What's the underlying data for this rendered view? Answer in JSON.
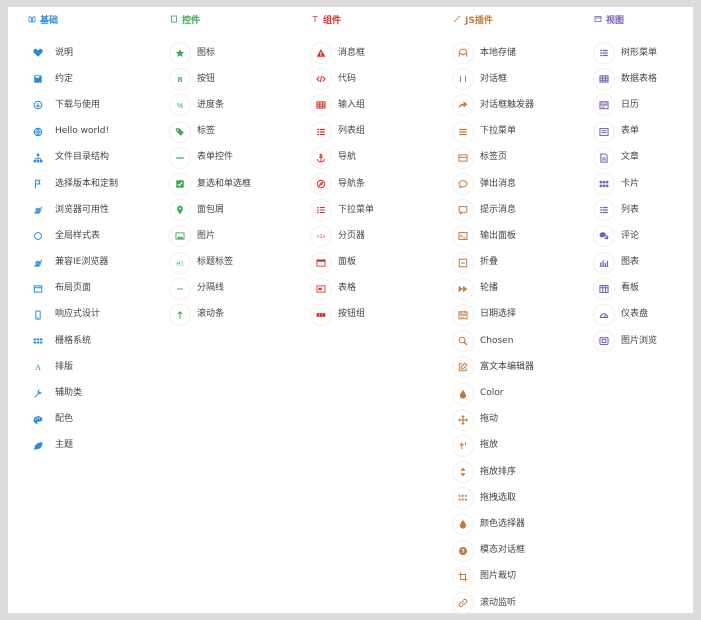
{
  "columns": [
    {
      "key": "base",
      "header": "基础",
      "icon": "book-icon",
      "color": "#2b8cd6",
      "items": [
        {
          "label": "说明",
          "icon": "heart-icon"
        },
        {
          "label": "约定",
          "icon": "save-icon"
        },
        {
          "label": "下载与使用",
          "icon": "download-icon"
        },
        {
          "label": "Hello world!",
          "icon": "globe-icon"
        },
        {
          "label": "文件目录结构",
          "icon": "sitemap-icon"
        },
        {
          "label": "选择版本和定制",
          "icon": "flag-icon"
        },
        {
          "label": "浏览器可用性",
          "icon": "ie-icon"
        },
        {
          "label": "全局样式表",
          "icon": "circle-icon"
        },
        {
          "label": "兼容IE浏览器",
          "icon": "ie-icon"
        },
        {
          "label": "布局页面",
          "icon": "window-icon"
        },
        {
          "label": "响应式设计",
          "icon": "mobile-icon"
        },
        {
          "label": "栅格系统",
          "icon": "grid-icon"
        },
        {
          "label": "排版",
          "icon": "font-icon"
        },
        {
          "label": "辅助类",
          "icon": "wrench-icon"
        },
        {
          "label": "配色",
          "icon": "palette-icon"
        },
        {
          "label": "主题",
          "icon": "leaf-icon"
        }
      ]
    },
    {
      "key": "widget",
      "header": "控件",
      "icon": "square-icon",
      "color": "#3aa94f",
      "items": [
        {
          "label": "图标",
          "icon": "star-icon"
        },
        {
          "label": "按钮",
          "icon": "bold-icon"
        },
        {
          "label": "进度条",
          "icon": "percent-icon"
        },
        {
          "label": "标签",
          "icon": "tags-icon"
        },
        {
          "label": "表单控件",
          "icon": "minus-icon"
        },
        {
          "label": "复选和单选框",
          "icon": "check-square-icon"
        },
        {
          "label": "面包屑",
          "icon": "pin-icon"
        },
        {
          "label": "图片",
          "icon": "image-icon"
        },
        {
          "label": "标题标签",
          "icon": "h-icon"
        },
        {
          "label": "分隔线",
          "icon": "dash-icon"
        },
        {
          "label": "滚动条",
          "icon": "arrow-up-icon"
        }
      ]
    },
    {
      "key": "comp",
      "header": "组件",
      "icon": "t-icon",
      "color": "#d9302c",
      "items": [
        {
          "label": "消息框",
          "icon": "warning-icon"
        },
        {
          "label": "代码",
          "icon": "code-icon"
        },
        {
          "label": "输入组",
          "icon": "table-icon"
        },
        {
          "label": "列表组",
          "icon": "list-icon"
        },
        {
          "label": "导航",
          "icon": "anchor-icon"
        },
        {
          "label": "导航条",
          "icon": "compass-icon"
        },
        {
          "label": "下拉菜单",
          "icon": "list-ul-icon"
        },
        {
          "label": "分页器",
          "icon": "pager-icon"
        },
        {
          "label": "面板",
          "icon": "panel-icon"
        },
        {
          "label": "表格",
          "icon": "card-icon"
        },
        {
          "label": "按钮组",
          "icon": "btn-group-icon"
        }
      ]
    },
    {
      "key": "js",
      "header": "JS插件",
      "icon": "magic-icon",
      "color": "#c67a3a",
      "items": [
        {
          "label": "本地存储",
          "icon": "archive-icon"
        },
        {
          "label": "对话框",
          "icon": "columns-icon"
        },
        {
          "label": "对话框触发器",
          "icon": "share-icon"
        },
        {
          "label": "下拉菜单",
          "icon": "bars-icon"
        },
        {
          "label": "标签页",
          "icon": "folder-icon"
        },
        {
          "label": "弹出消息",
          "icon": "comment-icon"
        },
        {
          "label": "提示消息",
          "icon": "comment-alt-icon"
        },
        {
          "label": "输出面板",
          "icon": "console-icon"
        },
        {
          "label": "折叠",
          "icon": "collapse-icon"
        },
        {
          "label": "轮播",
          "icon": "forward-icon"
        },
        {
          "label": "日期选择",
          "icon": "calendar-icon"
        },
        {
          "label": "Chosen",
          "icon": "search-icon"
        },
        {
          "label": "富文本编辑器",
          "icon": "edit-icon"
        },
        {
          "label": "Color",
          "icon": "drop-icon"
        },
        {
          "label": "拖动",
          "icon": "move-icon"
        },
        {
          "label": "拖放",
          "icon": "drag-icon"
        },
        {
          "label": "拖放排序",
          "icon": "sort-icon"
        },
        {
          "label": "拖拽选取",
          "icon": "select-icon"
        },
        {
          "label": "颜色选择器",
          "icon": "drop-icon"
        },
        {
          "label": "模态对话框",
          "icon": "question-icon"
        },
        {
          "label": "图片裁切",
          "icon": "crop-icon"
        },
        {
          "label": "滚动监听",
          "icon": "link-icon"
        }
      ]
    },
    {
      "key": "view",
      "header": "视图",
      "icon": "window-icon",
      "color": "#7a5bb5",
      "items": [
        {
          "label": "树形菜单",
          "icon": "list-icon"
        },
        {
          "label": "数据表格",
          "icon": "table-icon"
        },
        {
          "label": "日历",
          "icon": "calendar-icon"
        },
        {
          "label": "表单",
          "icon": "form-icon"
        },
        {
          "label": "文章",
          "icon": "doc-icon"
        },
        {
          "label": "卡片",
          "icon": "cards-icon"
        },
        {
          "label": "列表",
          "icon": "list-icon"
        },
        {
          "label": "评论",
          "icon": "comments-icon"
        },
        {
          "label": "图表",
          "icon": "chart-icon"
        },
        {
          "label": "看板",
          "icon": "board-icon"
        },
        {
          "label": "仪表盘",
          "icon": "dashboard-icon"
        },
        {
          "label": "图片浏览",
          "icon": "gallery-icon"
        }
      ]
    }
  ]
}
